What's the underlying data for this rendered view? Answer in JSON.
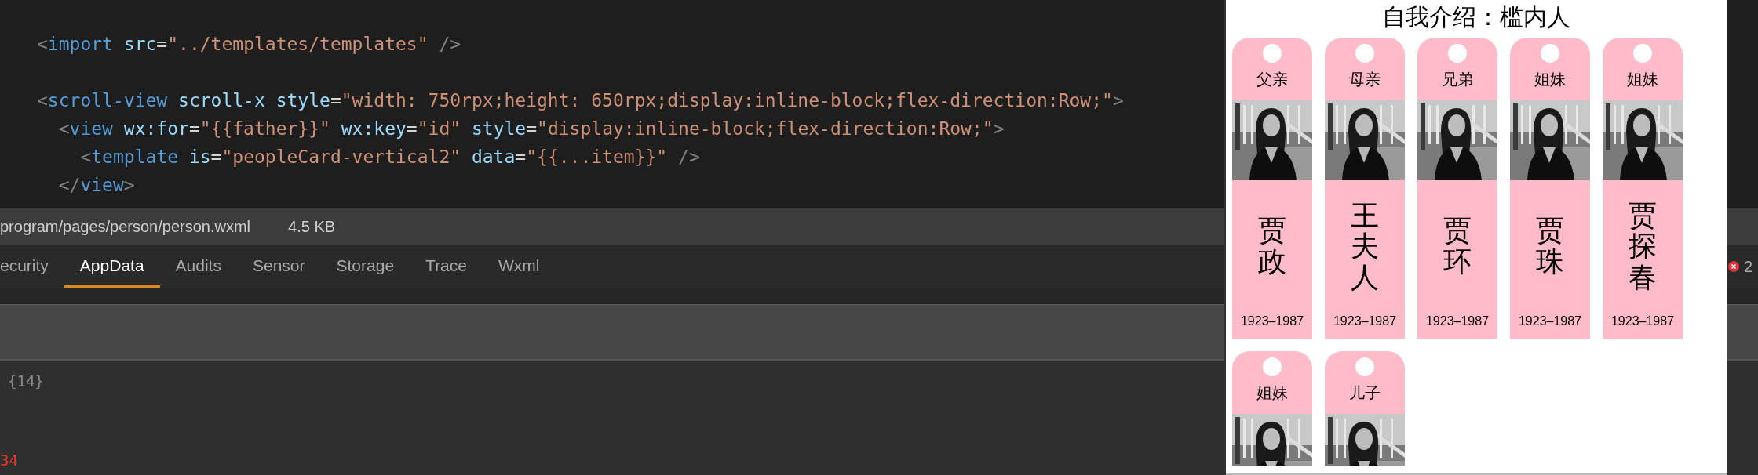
{
  "editor": {
    "blocks": [
      [
        [
          {
            "kind": "punct",
            "text": "<"
          },
          {
            "kind": "tag",
            "text": "import"
          },
          {
            "kind": "attr",
            "text": " src"
          },
          {
            "kind": "plain",
            "text": "="
          },
          {
            "kind": "string",
            "text": "\"../templates/templates\""
          },
          {
            "kind": "punct",
            "text": " />"
          }
        ]
      ],
      [
        [
          {
            "kind": "punct",
            "text": "<"
          },
          {
            "kind": "tag",
            "text": "scroll-view"
          },
          {
            "kind": "attr",
            "text": " scroll-x"
          },
          {
            "kind": "attr",
            "text": " style"
          },
          {
            "kind": "plain",
            "text": "="
          },
          {
            "kind": "string",
            "text": "\"width: 750rpx;height: 650rpx;display:inline-block;flex-direction:Row;\""
          },
          {
            "kind": "punct",
            "text": ">"
          }
        ],
        [
          {
            "kind": "punct",
            "text": "  <"
          },
          {
            "kind": "tag",
            "text": "view"
          },
          {
            "kind": "attr",
            "text": " wx:for"
          },
          {
            "kind": "plain",
            "text": "="
          },
          {
            "kind": "string",
            "text": "\"{{father}}\""
          },
          {
            "kind": "attr",
            "text": " wx:key"
          },
          {
            "kind": "plain",
            "text": "="
          },
          {
            "kind": "string",
            "text": "\"id\""
          },
          {
            "kind": "attr",
            "text": " style"
          },
          {
            "kind": "plain",
            "text": "="
          },
          {
            "kind": "string",
            "text": "\"display:inline-block;flex-direction:Row;\""
          },
          {
            "kind": "punct",
            "text": ">"
          }
        ],
        [
          {
            "kind": "punct",
            "text": "    <"
          },
          {
            "kind": "tag",
            "text": "template"
          },
          {
            "kind": "attr",
            "text": " is"
          },
          {
            "kind": "plain",
            "text": "="
          },
          {
            "kind": "string",
            "text": "\"peopleCard-vertical2\""
          },
          {
            "kind": "attr",
            "text": " data"
          },
          {
            "kind": "plain",
            "text": "="
          },
          {
            "kind": "string",
            "text": "\"{{...item}}\""
          },
          {
            "kind": "punct",
            "text": " />"
          }
        ],
        [
          {
            "kind": "punct",
            "text": "  </"
          },
          {
            "kind": "tag",
            "text": "view"
          },
          {
            "kind": "punct",
            "text": ">"
          }
        ]
      ]
    ]
  },
  "file_bar": {
    "path": "program/pages/person/person.wxml",
    "size": "4.5 KB"
  },
  "tabs": [
    {
      "label": "ecurity",
      "selected": false
    },
    {
      "label": "AppData",
      "selected": true
    },
    {
      "label": "Audits",
      "selected": false
    },
    {
      "label": "Sensor",
      "selected": false
    },
    {
      "label": "Storage",
      "selected": false
    },
    {
      "label": "Trace",
      "selected": false
    },
    {
      "label": "Wxml",
      "selected": false
    }
  ],
  "console": {
    "lines": [
      {
        "text": "{14}",
        "kind": "info"
      },
      {
        "text": "34",
        "kind": "error"
      }
    ]
  },
  "error_badge": {
    "count": "2"
  },
  "simulator": {
    "title": "自我介绍：槛内人",
    "cards": [
      {
        "relation": "父亲",
        "name": "贾政",
        "years": "1923–1987"
      },
      {
        "relation": "母亲",
        "name": "王夫人",
        "years": "1923–1987"
      },
      {
        "relation": "兄弟",
        "name": "贾环",
        "years": "1923–1987"
      },
      {
        "relation": "姐妹",
        "name": "贾珠",
        "years": "1923–1987"
      },
      {
        "relation": "姐妹",
        "name": "贾探春",
        "years": "1923–1987"
      },
      {
        "relation": "姐妹"
      },
      {
        "relation": "儿子"
      }
    ]
  }
}
